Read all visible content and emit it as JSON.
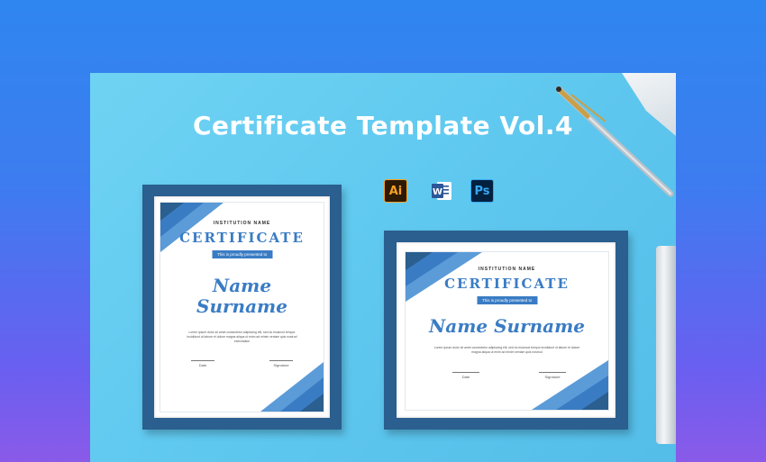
{
  "banner": {
    "title": "Certificate Template Vol.4"
  },
  "apps": [
    {
      "name": "illustrator-icon",
      "label": "Ai"
    },
    {
      "name": "word-icon",
      "label": "W"
    },
    {
      "name": "photoshop-icon",
      "label": "Ps"
    }
  ],
  "portrait_certificate": {
    "institution": "INSTITUTION NAME",
    "title": "CERTIFICATE",
    "presented": "This is proudly presented to",
    "name_line1": "Name",
    "name_line2": "Surname",
    "body": "Lorem ipsum dolor sit amet consectetur adipiscing elit, sed do eiusmod tempor incididunt ut labore et dolore magna aliqua ut enim ad minim veniam quis nostrud exercitation",
    "date_label": "Date",
    "signature_label": "Signature"
  },
  "landscape_certificate": {
    "institution": "INSTITUTION NAME",
    "title": "CERTIFICATE",
    "presented": "This is proudly presented to",
    "name": "Name Surname",
    "body": "Lorem ipsum dolor sit amet consectetur adipiscing elit, sed do eiusmod tempor incididunt ut labore et dolore magna aliqua ut enim ad minim veniam quis nostrud",
    "date_label": "Date",
    "signature_label": "Signature"
  },
  "colors": {
    "frame": "#2a5f8f",
    "accent": "#3a7cc4",
    "background": "#5fc8ef"
  }
}
